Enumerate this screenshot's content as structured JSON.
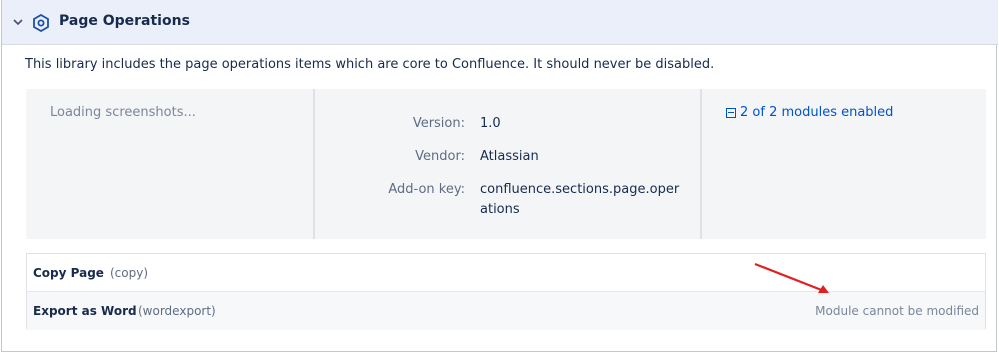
{
  "header": {
    "title": "Page Operations",
    "icon": "plugin-icon",
    "collapse_icon": "chevron-down-icon"
  },
  "description": "This library includes the page operations items which are core to Confluence. It should never be disabled.",
  "screenshots": {
    "loading_text": "Loading screenshots..."
  },
  "metadata": {
    "version_label": "Version:",
    "version_value": "1.0",
    "vendor_label": "Vendor:",
    "vendor_value": "Atlassian",
    "addon_key_label": "Add-on key:",
    "addon_key_value_line1": "confluence.sections.page.oper",
    "addon_key_value_line2": "ations"
  },
  "modules": {
    "summary": "2 of 2 modules enabled",
    "items": [
      {
        "name": "Copy Page",
        "key": "(copy)",
        "status": ""
      },
      {
        "name": "Export as Word",
        "key": "(wordexport)",
        "status": "Module cannot be modified"
      }
    ]
  },
  "colors": {
    "header_bg": "#ebeffa",
    "link": "#0052cc",
    "icon": "#1d4fa8",
    "annotation_arrow": "#e02020"
  }
}
